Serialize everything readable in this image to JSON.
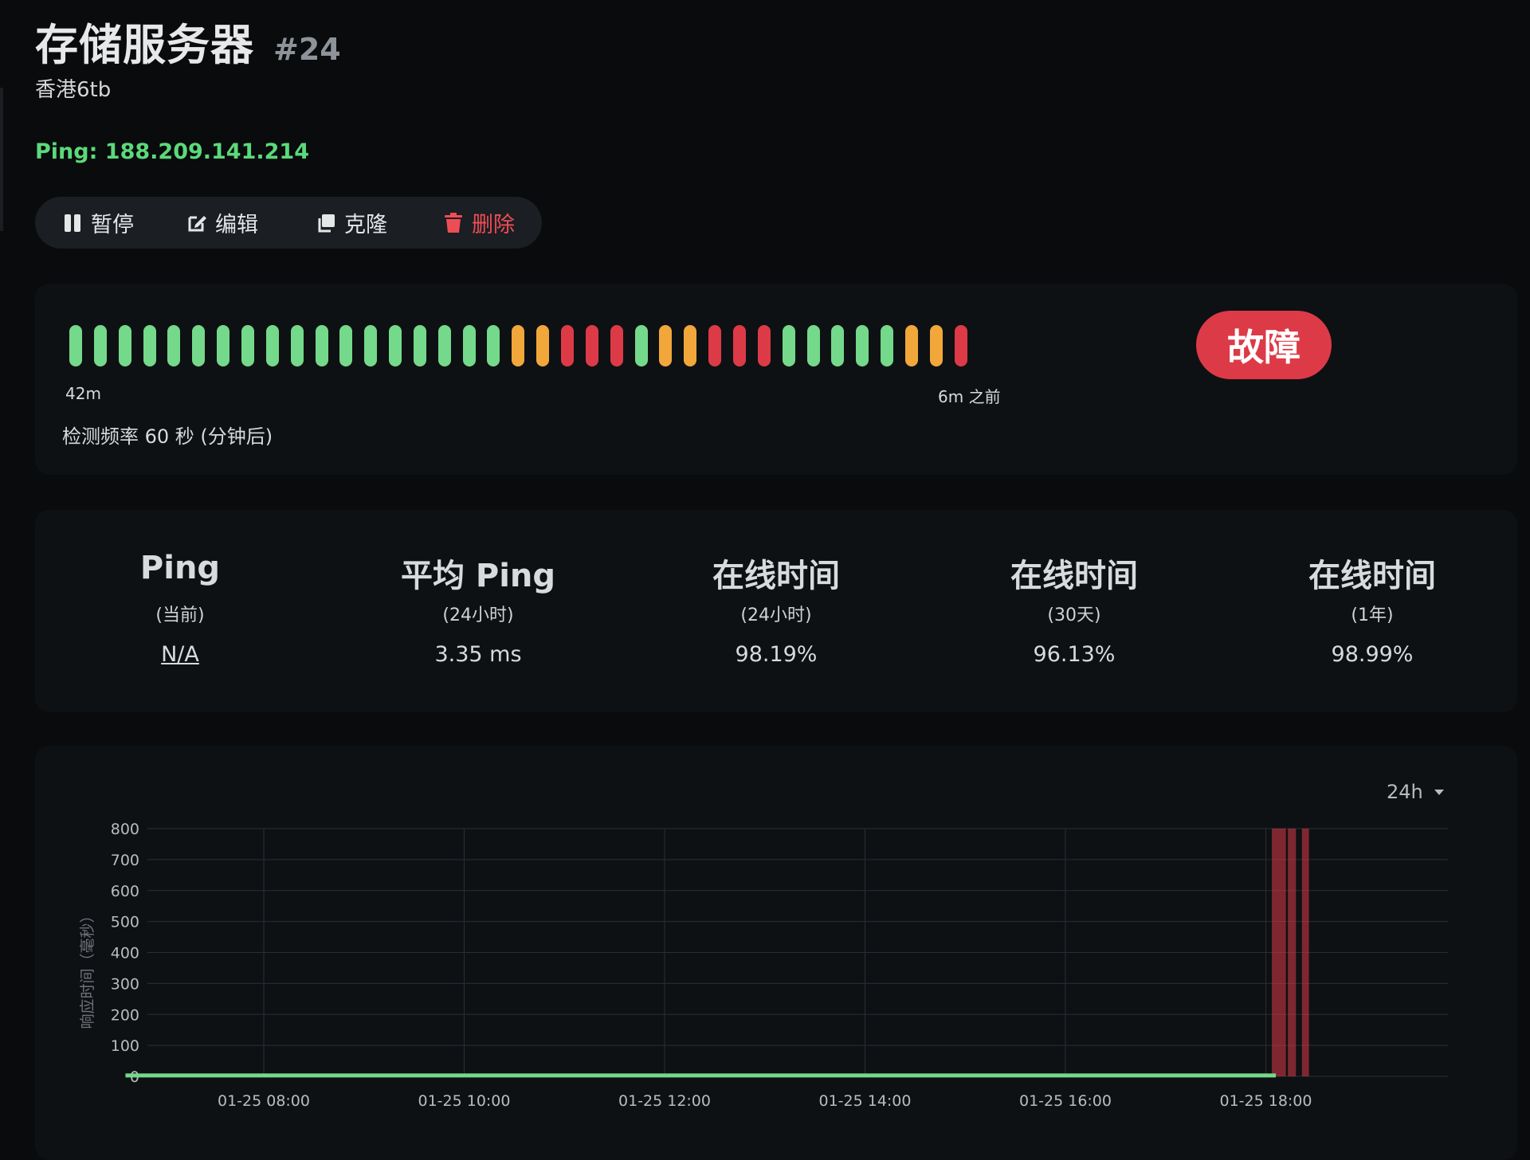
{
  "monitor": {
    "title": "存储服务器",
    "id": "#24",
    "description": "香港6tb",
    "ping_label": "Ping: 188.209.141.214"
  },
  "toolbar": {
    "pause": "暂停",
    "edit": "编辑",
    "clone": "克隆",
    "delete": "删除"
  },
  "heartbeat": {
    "beats": [
      "up",
      "up",
      "up",
      "up",
      "up",
      "up",
      "up",
      "up",
      "up",
      "up",
      "up",
      "up",
      "up",
      "up",
      "up",
      "up",
      "up",
      "up",
      "pending",
      "pending",
      "down",
      "down",
      "down",
      "up",
      "pending",
      "pending",
      "down",
      "down",
      "down",
      "up",
      "up",
      "up",
      "up",
      "up",
      "pending",
      "pending",
      "down"
    ],
    "colors": {
      "up": "#74d98a",
      "pending": "#f1a73a",
      "down": "#dd3a47"
    },
    "start_label": "42m",
    "end_label": "6m 之前",
    "interval_text": "检测频率 60 秒 (分钟后)",
    "status": "故障"
  },
  "stats": [
    {
      "title": "Ping",
      "sub": "(当前)",
      "value": "N/A",
      "link": true
    },
    {
      "title": "平均 Ping",
      "sub": "(24小时)",
      "value": "3.35 ms",
      "link": false
    },
    {
      "title": "在线时间",
      "sub": "(24小时)",
      "value": "98.19%",
      "link": false
    },
    {
      "title": "在线时间",
      "sub": "(30天)",
      "value": "96.13%",
      "link": false
    },
    {
      "title": "在线时间",
      "sub": "(1年)",
      "value": "98.99%",
      "link": false
    }
  ],
  "chart_range": "24h",
  "chart_data": {
    "type": "line",
    "ylabel": "响应时间（毫秒）",
    "ylim": [
      0,
      800
    ],
    "yticks": [
      0,
      100,
      200,
      300,
      400,
      500,
      600,
      700,
      800
    ],
    "xticks": [
      "01-25 08:00",
      "01-25 10:00",
      "01-25 12:00",
      "01-25 14:00",
      "01-25 16:00",
      "01-25 18:00"
    ],
    "x_range_hours": [
      6.75,
      18.3
    ],
    "line_color": "#74d98a",
    "series": [
      {
        "values": [
          [
            6.62,
            3
          ],
          [
            18.1,
            3
          ]
        ]
      }
    ],
    "down_periods": [
      [
        18.06,
        18.2
      ],
      [
        18.22,
        18.3
      ],
      [
        18.36,
        18.43
      ]
    ],
    "down_color": "#dd3a47"
  }
}
